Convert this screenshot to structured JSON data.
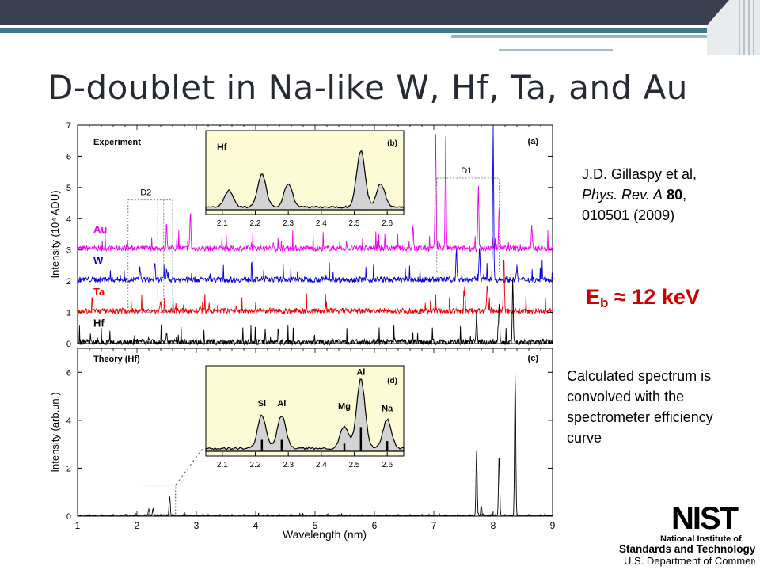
{
  "slide": {
    "title": "D-doublet in Na-like W, Hf, Ta, and Au",
    "reference": {
      "authors": "J.D. Gillaspy et al,",
      "journal": "Phys. Rev. A",
      "volume": "80",
      "pages": "010501 (2009)"
    },
    "energy": {
      "symbol": "E",
      "subscript": "b",
      "approx": "≈",
      "value": "12 keV"
    },
    "calc_note": "Calculated spectrum is convolved with the spectrometer efficiency curve",
    "logo": {
      "mark": "NIST",
      "line1": "National Institute of",
      "line2": "Standards and Technology",
      "line3": "U.S. Department of Commerce"
    }
  },
  "colors": {
    "Au": "#ee00ee",
    "W": "#0000dd",
    "Ta": "#ee0000",
    "Hf": "#000000",
    "inset_fill": "#fdfbd6",
    "peak_fill": "#d3d3d3"
  },
  "chart_data": [
    {
      "type": "line",
      "panel": "(a)",
      "annotation": "Experiment",
      "ylabel": "Intensity (10⁴ ADU)",
      "xlim": [
        1,
        9
      ],
      "ylim": [
        0,
        7
      ],
      "yticks": [
        0,
        1,
        2,
        3,
        4,
        5,
        6,
        7
      ],
      "labels": [
        "D2",
        "D1"
      ],
      "series": [
        {
          "name": "Au",
          "offset": 3.0,
          "peaks": [
            [
              2.5,
              0.8
            ],
            [
              2.9,
              1.2
            ],
            [
              6.65,
              0.8
            ],
            [
              7.03,
              3.8
            ],
            [
              7.2,
              3.5
            ],
            [
              7.75,
              2.0
            ],
            [
              8.1,
              1.4
            ],
            [
              8.65,
              0.7
            ]
          ]
        },
        {
          "name": "W",
          "offset": 2.0,
          "peaks": [
            [
              2.05,
              0.4
            ],
            [
              2.3,
              0.5
            ],
            [
              2.5,
              0.3
            ],
            [
              7.38,
              1.0
            ],
            [
              7.77,
              1.1
            ],
            [
              8.0,
              4.8
            ],
            [
              8.4,
              0.4
            ]
          ]
        },
        {
          "name": "Ta",
          "offset": 1.0,
          "peaks": [
            [
              2.4,
              0.3
            ],
            [
              7.52,
              0.8
            ],
            [
              7.9,
              0.9
            ],
            [
              8.18,
              1.8
            ]
          ]
        },
        {
          "name": "Hf",
          "offset": 0.0,
          "peaks": [
            [
              2.2,
              0.2
            ],
            [
              2.5,
              0.3
            ],
            [
              7.72,
              0.9
            ],
            [
              8.1,
              1.3
            ],
            [
              8.33,
              2.0
            ]
          ]
        }
      ]
    },
    {
      "type": "area",
      "panel": "(b)",
      "annotation": "Hf",
      "xlim": [
        2.05,
        2.65
      ],
      "xticks": [
        2.1,
        2.2,
        2.3,
        2.4,
        2.5,
        2.6
      ],
      "peaks": [
        [
          2.12,
          0.25
        ],
        [
          2.22,
          0.5
        ],
        [
          2.3,
          0.35
        ],
        [
          2.52,
          0.85
        ],
        [
          2.58,
          0.35
        ]
      ]
    },
    {
      "type": "line",
      "panel": "(c)",
      "annotation": "Theory (Hf)",
      "xlabel": "Wavelength (nm)",
      "ylabel": "Intensity (arb.un.)",
      "xlim": [
        1,
        9
      ],
      "ylim": [
        0,
        7
      ],
      "xticks": [
        1,
        2,
        3,
        4,
        5,
        6,
        7,
        8,
        9
      ],
      "yticks": [
        0,
        2,
        4,
        6
      ],
      "peaks": [
        [
          2.2,
          0.3
        ],
        [
          2.27,
          0.3
        ],
        [
          2.55,
          0.8
        ],
        [
          7.72,
          2.7
        ],
        [
          7.8,
          0.4
        ],
        [
          8.1,
          2.6
        ],
        [
          8.37,
          6.0
        ]
      ]
    },
    {
      "type": "area",
      "panel": "(d)",
      "xlim": [
        2.05,
        2.65
      ],
      "xticks": [
        2.1,
        2.2,
        2.3,
        2.4,
        2.5,
        2.6
      ],
      "ion_labels": [
        "Si",
        "Al",
        "Mg",
        "Al",
        "Na"
      ],
      "peaks": [
        [
          2.22,
          0.45
        ],
        [
          2.28,
          0.45
        ],
        [
          2.47,
          0.3
        ],
        [
          2.52,
          0.95
        ],
        [
          2.6,
          0.4
        ]
      ]
    }
  ]
}
